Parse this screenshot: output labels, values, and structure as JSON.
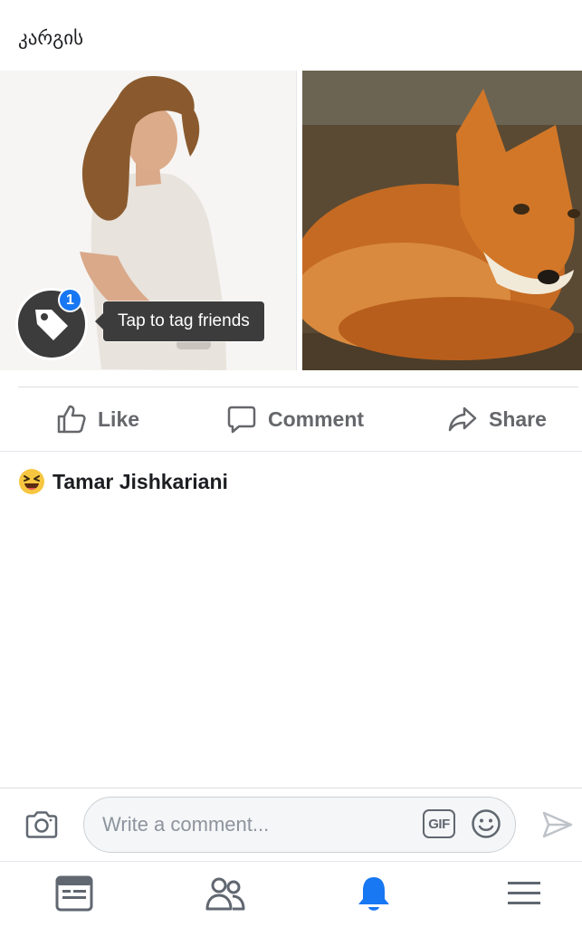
{
  "post": {
    "text": "კარგის"
  },
  "photos": [
    {
      "name": "photo-woman"
    },
    {
      "name": "photo-fox"
    }
  ],
  "tag_prompt": {
    "badge_count": "1",
    "tooltip": "Tap to tag friends"
  },
  "actions": {
    "like": "Like",
    "comment": "Comment",
    "share": "Share"
  },
  "reaction": {
    "emoji": "laughing-emoji",
    "name": "Tamar Jishkariani"
  },
  "composer": {
    "placeholder": "Write a comment...",
    "gif_label": "GIF"
  },
  "tabbar": {
    "items": [
      "news-feed-icon",
      "friends-icon",
      "notifications-bell-icon",
      "menu-icon"
    ],
    "active": "notifications-bell-icon",
    "active_color": "#1877f2",
    "inactive_color": "#606770"
  },
  "colors": {
    "action_text": "#65676b",
    "accent": "#1877f2",
    "tooltip_bg": "#3c3c3c"
  }
}
